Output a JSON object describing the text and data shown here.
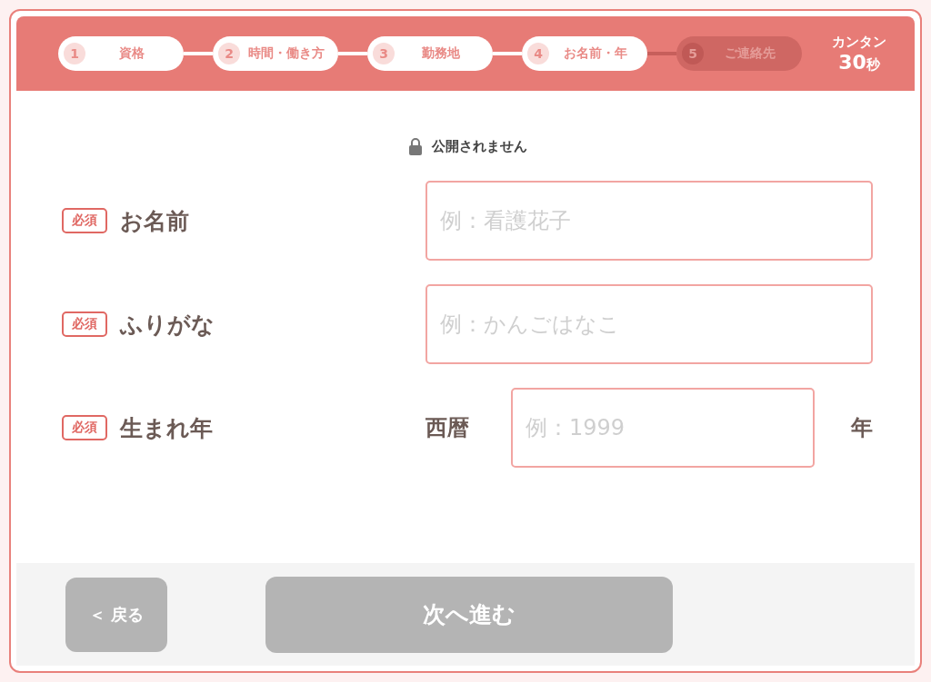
{
  "steps": [
    {
      "number": "1",
      "label": "資格",
      "done": true
    },
    {
      "number": "2",
      "label": "時間・働き方",
      "done": true
    },
    {
      "number": "3",
      "label": "勤務地",
      "done": true
    },
    {
      "number": "4",
      "label": "お名前・年",
      "done": true
    },
    {
      "number": "5",
      "label": "ご連絡先",
      "done": false
    }
  ],
  "badge": {
    "line1": "カンタン",
    "line2": "30",
    "unit": "秒"
  },
  "privacy_note": "公開されません",
  "fields": [
    {
      "kind": "text",
      "required": true,
      "required_label": "必須",
      "label": "お名前",
      "placeholder": "例：看護花子"
    },
    {
      "kind": "text",
      "required": true,
      "required_label": "必須",
      "label": "ふりがな",
      "placeholder": "例：かんごはなこ"
    },
    {
      "kind": "year",
      "required": true,
      "required_label": "必須",
      "label": "生まれ年",
      "prefix": "西暦",
      "placeholder": "例：1999",
      "suffix": "年"
    }
  ],
  "buttons": {
    "back": {
      "label": "＜ 戻る",
      "disabled": true
    },
    "next": {
      "label": "次へ進む",
      "disabled": true
    }
  }
}
